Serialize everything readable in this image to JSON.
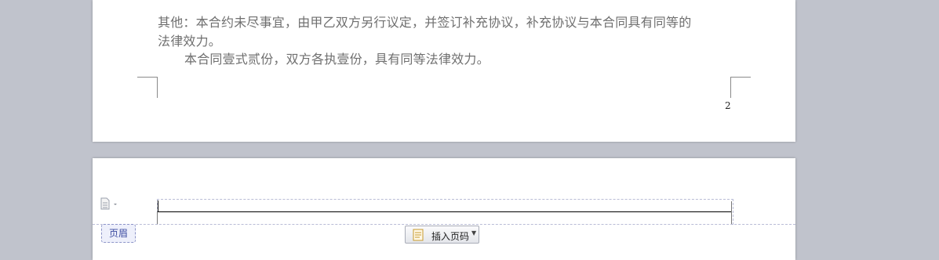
{
  "document": {
    "previous_page": {
      "lines": [
        "其他：本合约未尽事宜，由甲乙双方另行议定，并签订补充协议，补充协议与本合同具有同等的",
        "法律效力。",
        "本合同壹式贰份，双方各执壹份，具有同等法律效力。"
      ],
      "page_number": "2"
    },
    "next_page": {
      "header_label": "页眉",
      "insert_page_number_label": "插入页码",
      "header_menu_icon": "document-options-icon",
      "insert_icon": "page-number-icon"
    }
  }
}
